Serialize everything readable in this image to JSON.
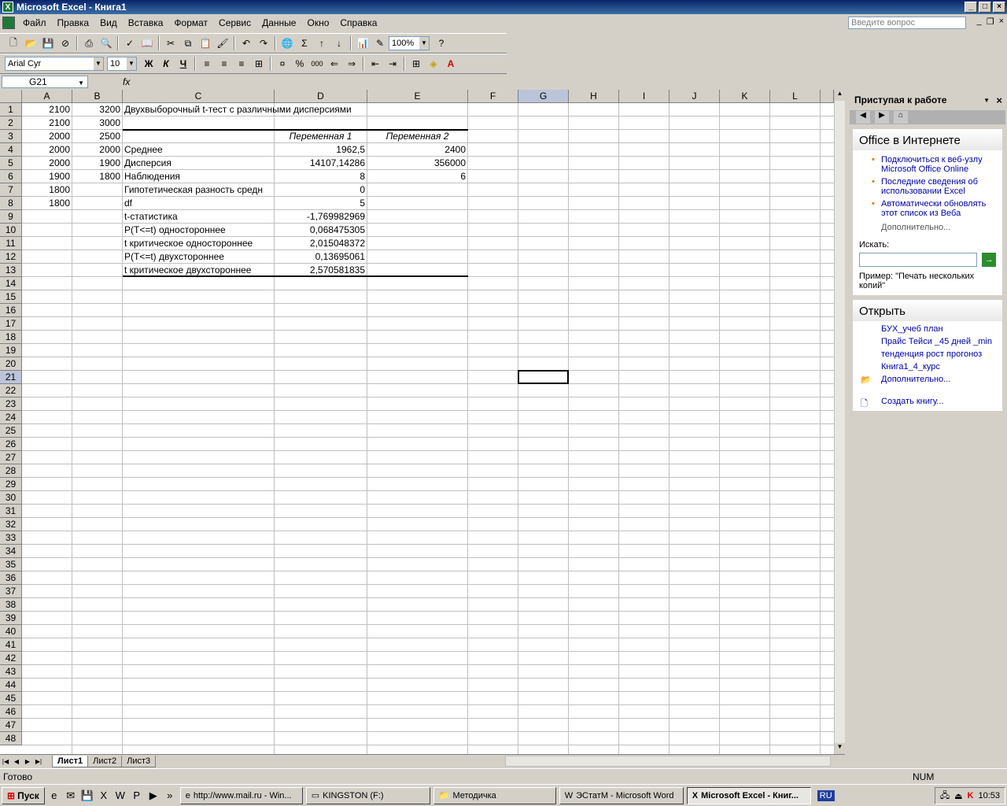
{
  "window": {
    "title": "Microsoft Excel - Книга1"
  },
  "menu": {
    "items": [
      "Файл",
      "Правка",
      "Вид",
      "Вставка",
      "Формат",
      "Сервис",
      "Данные",
      "Окно",
      "Справка"
    ],
    "ask_placeholder": "Введите вопрос"
  },
  "toolbar": {
    "zoom": "100%",
    "font": "Arial Cyr",
    "size": "10",
    "bold": "Ж",
    "italic": "К",
    "underline": "Ч",
    "percent": "%",
    "thousands": "000",
    "sigma": "Σ"
  },
  "formula_bar": {
    "cell_ref": "G21",
    "fx": "fx",
    "value": ""
  },
  "columns": [
    "A",
    "B",
    "C",
    "D",
    "E",
    "F",
    "G",
    "H",
    "I",
    "J",
    "K",
    "L"
  ],
  "cells": {
    "A1": "2100",
    "B1": "3200",
    "C1": "Двухвыборочный t-тест с различными дисперсиями",
    "A2": "2100",
    "B2": "3000",
    "A3": "2000",
    "B3": "2500",
    "D3": "Переменная 1",
    "E3": "Переменная 2",
    "A4": "2000",
    "B4": "2000",
    "C4": "Среднее",
    "D4": "1962,5",
    "E4": "2400",
    "A5": "2000",
    "B5": "1900",
    "C5": "Дисперсия",
    "D5": "14107,14286",
    "E5": "356000",
    "A6": "1900",
    "B6": "1800",
    "C6": "Наблюдения",
    "D6": "8",
    "E6": "6",
    "A7": "1800",
    "C7": "Гипотетическая разность средн",
    "D7": "0",
    "A8": "1800",
    "C8": "df",
    "D8": "5",
    "C9": "t-статистика",
    "D9": "-1,769982969",
    "C10": "P(T<=t) одностороннее",
    "D10": "0,068475305",
    "C11": "t критическое одностороннее",
    "D11": "2,015048372",
    "C12": "P(T<=t) двухстороннее",
    "D12": "0,13695061",
    "C13": "t критическое двухстороннее",
    "D13": "2,570581835"
  },
  "sheets": {
    "tabs": [
      "Лист1",
      "Лист2",
      "Лист3"
    ],
    "active": "Лист1"
  },
  "task_pane": {
    "title": "Приступая к работе",
    "online_heading": "Office в Интернете",
    "online_links": [
      "Подключиться к веб-узлу Microsoft Office Online",
      "Последние сведения об использовании Excel",
      "Автоматически обновлять этот список из Веба"
    ],
    "more1": "Дополнительно...",
    "search_label": "Искать:",
    "example": "Пример: \"Печать нескольких копий\"",
    "open_heading": "Открыть",
    "files": [
      "БУХ_учеб план",
      "Прайс Тейси _45 дней _min",
      "тенденция рост прогоноз",
      "Книга1_4_курс"
    ],
    "more2": "Дополнительно...",
    "create": "Создать книгу..."
  },
  "status": {
    "ready": "Готово",
    "num": "NUM"
  },
  "taskbar": {
    "start": "Пуск",
    "tasks": [
      "http://www.mail.ru - Win...",
      "KINGSTON (F:)",
      "Методичка",
      "ЭСтатМ - Microsoft Word",
      "Microsoft Excel - Книг..."
    ],
    "lang": "RU",
    "clock": "10:53"
  },
  "colors": {
    "title_bar": "#0a246a",
    "grid_line": "#c0c0c0",
    "link": "#0000aa"
  }
}
